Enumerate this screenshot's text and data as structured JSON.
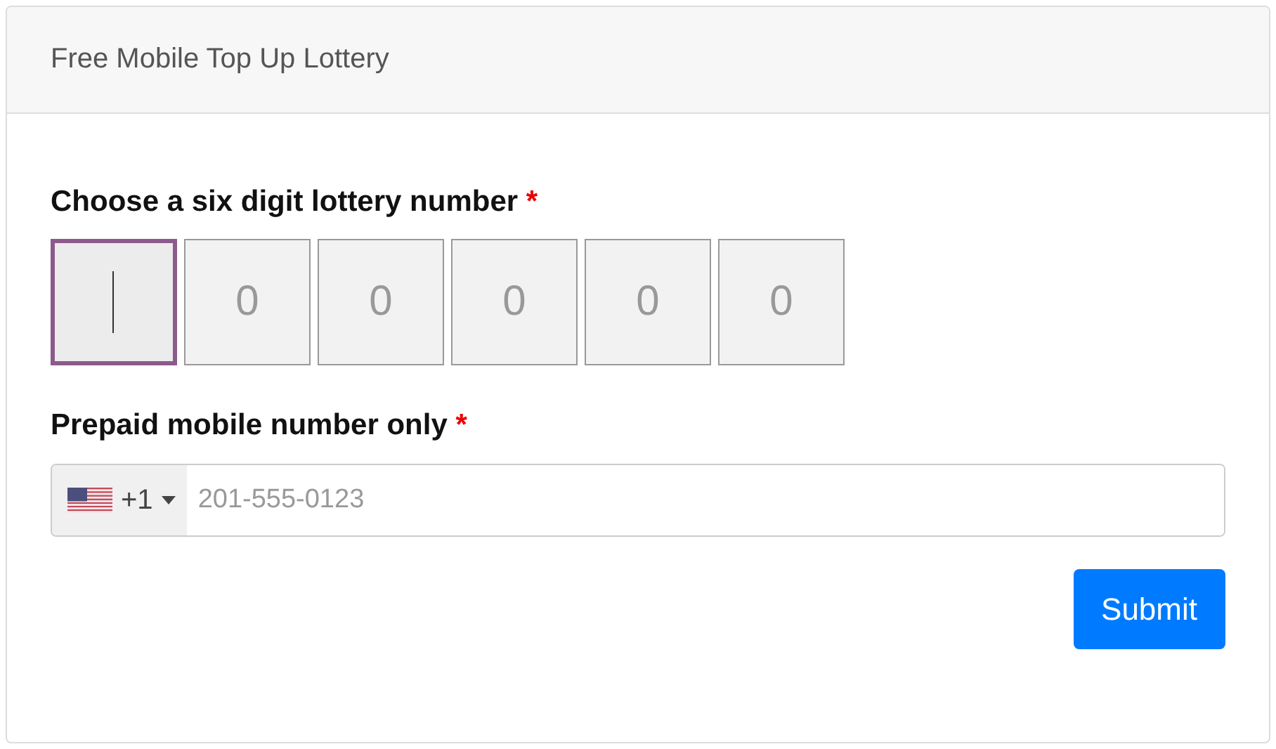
{
  "card": {
    "title": "Free Mobile Top Up Lottery"
  },
  "lottery": {
    "label": "Choose a six digit lottery number",
    "required": "*",
    "digits": [
      {
        "focused": true
      },
      {
        "placeholder": "0",
        "focused": false
      },
      {
        "placeholder": "0",
        "focused": false
      },
      {
        "placeholder": "0",
        "focused": false
      },
      {
        "placeholder": "0",
        "focused": false
      },
      {
        "placeholder": "0",
        "focused": false
      }
    ]
  },
  "phone": {
    "label": "Prepaid mobile number only",
    "required": "*",
    "dial_code": "+1",
    "placeholder": "201-555-0123"
  },
  "buttons": [
    {
      "label": "Submit"
    }
  ]
}
